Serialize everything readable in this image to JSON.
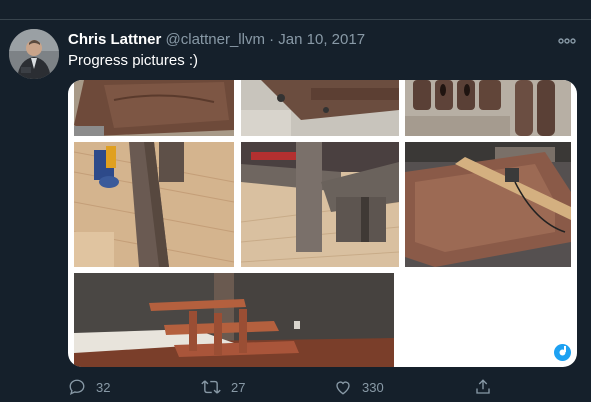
{
  "tweet": {
    "author_name": "Chris Lattner",
    "handle": "@clattner_llvm",
    "separator": "·",
    "date": "Jan 10, 2017",
    "text": "Progress pictures :)"
  },
  "media": {
    "photos": [
      "workbench",
      "clamped-rail",
      "carved-legs",
      "clamped-board",
      "joint-closeup",
      "slab-router",
      "table-frame"
    ]
  },
  "actions": {
    "replies": "32",
    "retweets": "27",
    "likes": "330"
  },
  "colors": {
    "background": "#15202b",
    "secondary_text": "#8899a6",
    "divider": "#38444d",
    "accent": "#1da1f2"
  }
}
